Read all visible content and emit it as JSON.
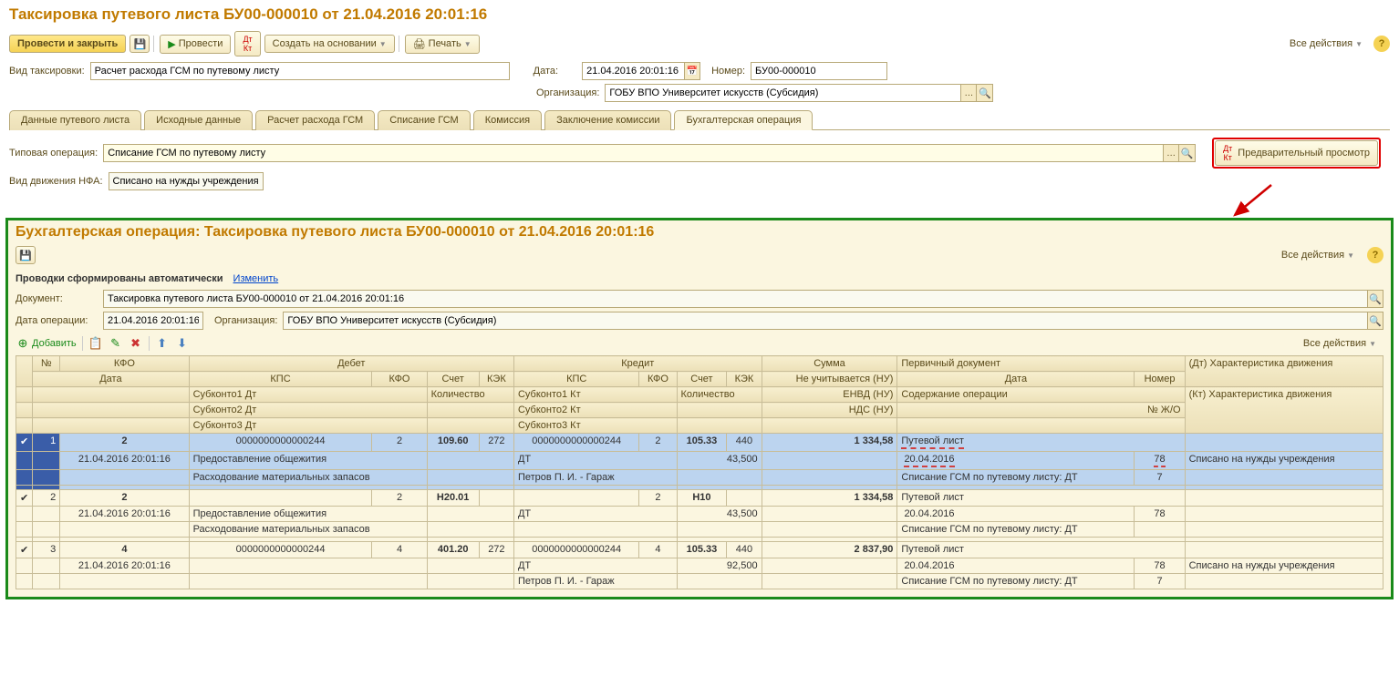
{
  "header": {
    "title": "Таксировка путевого листа БУ00-000010 от 21.04.2016 20:01:16"
  },
  "toolbar": {
    "post_close": "Провести и закрыть",
    "post": "Провести",
    "create_based": "Создать на основании",
    "print": "Печать",
    "all_actions": "Все действия"
  },
  "form": {
    "tax_type_label": "Вид таксировки:",
    "tax_type_value": "Расчет расхода ГСМ по путевому листу",
    "date_label": "Дата:",
    "date_value": "21.04.2016 20:01:16",
    "number_label": "Номер:",
    "number_value": "БУ00-000010",
    "org_label": "Организация:",
    "org_value": "ГОБУ ВПО Университет искусств (Субсидия)"
  },
  "tabs": {
    "t1": "Данные путевого листа",
    "t2": "Исходные данные",
    "t3": "Расчет расхода ГСМ",
    "t4": "Списание ГСМ",
    "t5": "Комиссия",
    "t6": "Заключение комиссии",
    "t7": "Бухгалтерская операция"
  },
  "acc_op": {
    "typical_label": "Типовая операция:",
    "typical_value": "Списание ГСМ по путевому листу",
    "nfa_label": "Вид движения НФА:",
    "nfa_value": "Списано на нужды учреждения",
    "preview_btn": "Предварительный просмотр"
  },
  "panel": {
    "title": "Бухгалтерская операция: Таксировка путевого листа БУ00-000010 от 21.04.2016 20:01:16",
    "all_actions": "Все действия",
    "auto_text": "Проводки сформированы автоматически",
    "change_link": "Изменить",
    "doc_label": "Документ:",
    "doc_value": "Таксировка путевого листа БУ00-000010 от 21.04.2016 20:01:16",
    "opdate_label": "Дата операции:",
    "opdate_value": "21.04.2016 20:01:16",
    "org_label": "Организация:",
    "org_value": "ГОБУ ВПО Университет искусств (Субсидия)",
    "add_btn": "Добавить"
  },
  "grid_headers": {
    "num": "№",
    "kfo": "КФО",
    "debit": "Дебет",
    "credit": "Кредит",
    "sum": "Сумма",
    "primary_doc": "Первичный документ",
    "dt_char": "(Дт) Характеристика движения",
    "date": "Дата",
    "kps": "КПС",
    "kfo2": "КФО",
    "account": "Счет",
    "kek": "КЭК",
    "not_acc": "Не учитывается (НУ)",
    "num2": "Номер",
    "kt_char": "(Кт) Характеристика движения",
    "sub1dt": "Субконто1 Дт",
    "qty": "Количество",
    "sub1kt": "Субконто1 Кт",
    "envd": "ЕНВД (НУ)",
    "op_content": "Содержание операции",
    "jo": "№ Ж/О",
    "sub2dt": "Субконто2 Дт",
    "sub2kt": "Субконто2 Кт",
    "nds": "НДС (НУ)",
    "sub3dt": "Субконто3 Дт",
    "sub3kt": "Субконто3 Кт"
  },
  "rows": [
    {
      "n": "1",
      "kfo_top": "2",
      "date": "21.04.2016 20:01:16",
      "d_kps": "0000000000000244",
      "d_kfo": "2",
      "d_acc": "109.60",
      "d_kek": "272",
      "d_sub1": "Предоставление общежития",
      "d_sub2": "Расходование материальных запасов",
      "c_kps": "0000000000000244",
      "c_kfo": "2",
      "c_acc": "105.33",
      "c_kek": "440",
      "c_sub1": "ДТ",
      "c_qty": "43,500",
      "c_sub2": "Петров П. И. - Гараж",
      "sum": "1 334,58",
      "pdoc": "Путевой лист",
      "pdate": "20.04.2016",
      "pnum": "78",
      "content": "Списание ГСМ по путевому листу: ДТ",
      "jo": "7",
      "char": "Списано на нужды учреждения"
    },
    {
      "n": "2",
      "kfo_top": "2",
      "date": "21.04.2016 20:01:16",
      "d_kps": "",
      "d_kfo": "2",
      "d_acc": "Н20.01",
      "d_kek": "",
      "d_sub1": "Предоставление общежития",
      "d_sub2": "Расходование материальных запасов",
      "c_kps": "",
      "c_kfo": "2",
      "c_acc": "Н10",
      "c_kek": "",
      "c_sub1": "ДТ",
      "c_qty": "43,500",
      "c_sub2": "",
      "sum": "1 334,58",
      "pdoc": "Путевой лист",
      "pdate": "20.04.2016",
      "pnum": "78",
      "content": "Списание ГСМ по путевому листу: ДТ",
      "jo": "",
      "char": ""
    },
    {
      "n": "3",
      "kfo_top": "4",
      "date": "21.04.2016 20:01:16",
      "d_kps": "0000000000000244",
      "d_kfo": "4",
      "d_acc": "401.20",
      "d_kek": "272",
      "d_sub1": "",
      "d_sub2": "",
      "c_kps": "0000000000000244",
      "c_kfo": "4",
      "c_acc": "105.33",
      "c_kek": "440",
      "c_sub1": "ДТ",
      "c_qty": "92,500",
      "c_sub2": "Петров П. И. - Гараж",
      "sum": "2 837,90",
      "pdoc": "Путевой лист",
      "pdate": "20.04.2016",
      "pnum": "78",
      "content": "Списание ГСМ по путевому листу: ДТ",
      "jo": "7",
      "char": "Списано на нужды учреждения"
    }
  ]
}
